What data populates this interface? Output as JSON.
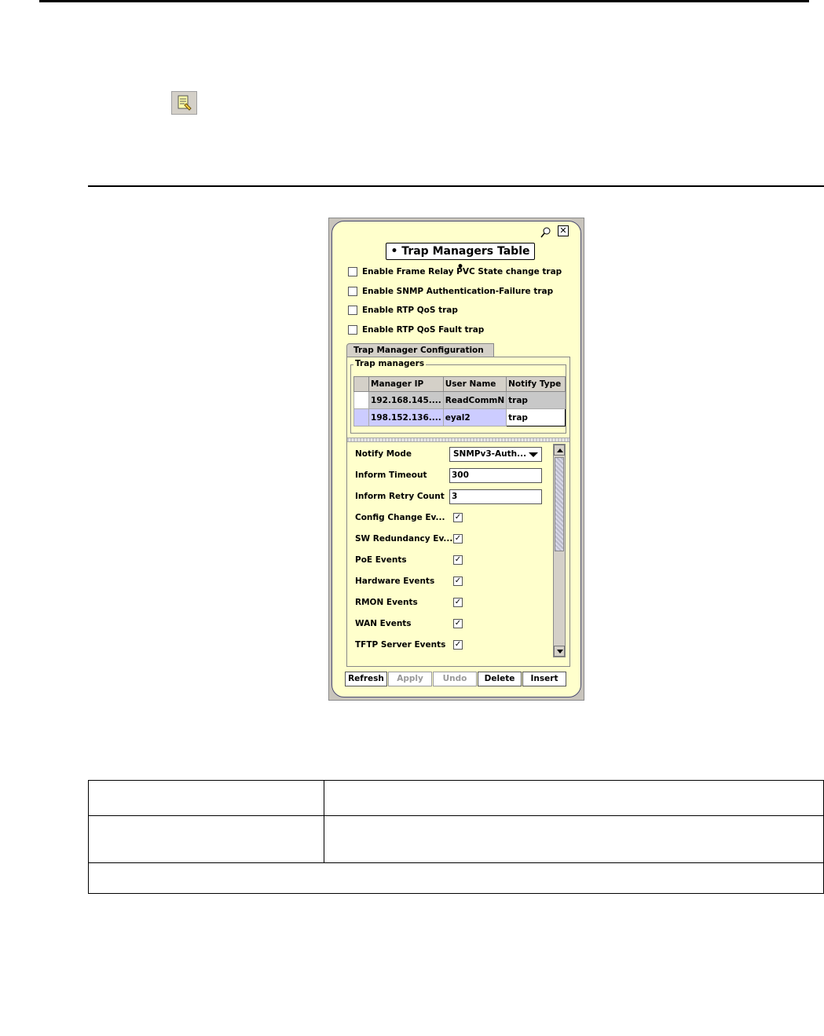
{
  "panel": {
    "title": "• Trap Managers Table •",
    "checkboxes": [
      {
        "label": "Enable Frame Relay PVC State change trap",
        "checked": false
      },
      {
        "label": "Enable SNMP Authentication-Failure trap",
        "checked": false
      },
      {
        "label": "Enable RTP QoS trap",
        "checked": false
      },
      {
        "label": "Enable RTP QoS Fault trap",
        "checked": false
      }
    ],
    "tab_label": "Trap Manager Configuration",
    "group_label": "Trap managers",
    "table": {
      "headers": [
        "Manager IP",
        "User Name",
        "Notify Type"
      ],
      "rows": [
        [
          "192.168.145....",
          "ReadCommN",
          "trap"
        ],
        [
          "198.152.136....",
          "eyal2",
          "trap"
        ]
      ]
    },
    "properties": {
      "notify_mode_label": "Notify Mode",
      "notify_mode_value": "SNMPv3-Auth...",
      "inform_timeout_label": "Inform Timeout",
      "inform_timeout_value": "300",
      "inform_retry_label": "Inform Retry Count",
      "inform_retry_value": "3",
      "events": [
        {
          "label": "Config Change Ev...",
          "checked": true
        },
        {
          "label": "SW Redundancy Ev...",
          "checked": true
        },
        {
          "label": "PoE Events",
          "checked": true
        },
        {
          "label": "Hardware Events",
          "checked": true
        },
        {
          "label": "RMON Events",
          "checked": true
        },
        {
          "label": "WAN Events",
          "checked": true
        },
        {
          "label": "TFTP Server Events",
          "checked": true
        }
      ]
    },
    "buttons": {
      "refresh": "Refresh",
      "apply": "Apply",
      "undo": "Undo",
      "delete": "Delete",
      "insert": "Insert"
    },
    "check_mark": "✓",
    "close_glyph": "✕"
  }
}
